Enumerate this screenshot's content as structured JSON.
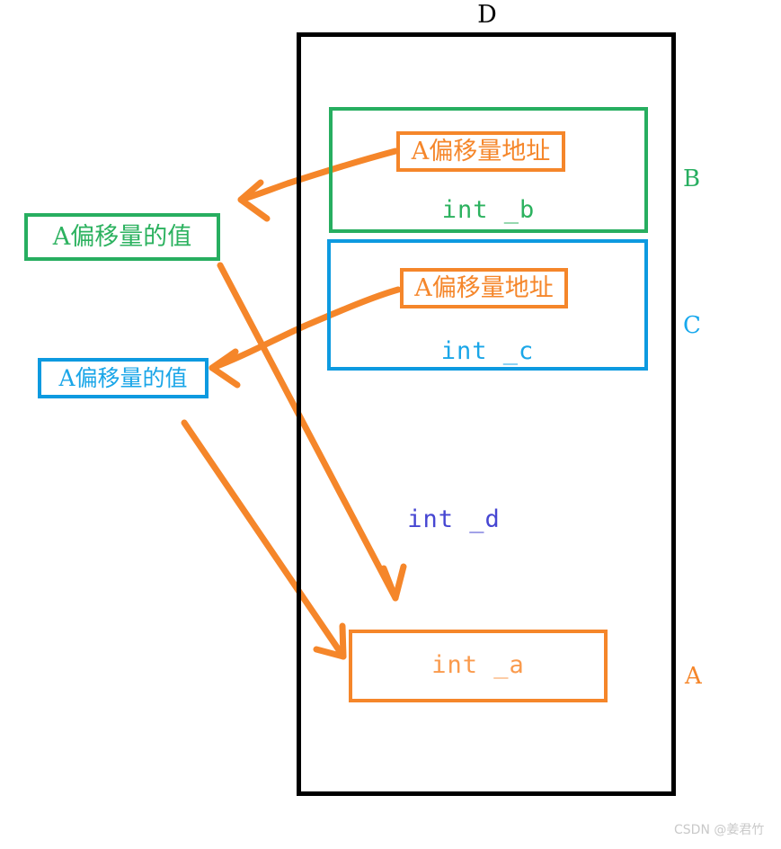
{
  "diagram": {
    "title_label": "D",
    "outer_block": {
      "name": "outer-struct-d",
      "label": "D",
      "color": "#000000"
    },
    "blocks": [
      {
        "id": "b",
        "side_label": "B",
        "color": "#27ae60",
        "member": "int _b",
        "address_box": "A偏移量地址"
      },
      {
        "id": "c",
        "side_label": "C",
        "color": "#0d9ae0",
        "member": "int _c",
        "address_box": "A偏移量地址"
      },
      {
        "id": "a",
        "side_label": "A",
        "color": "#f5862a",
        "member": "int _a",
        "address_box": null
      }
    ],
    "d_member": "int _d",
    "value_boxes": [
      {
        "id": "val-b",
        "text": "A偏移量的值",
        "color": "#27ae60"
      },
      {
        "id": "val-c",
        "text": "A偏移量的值",
        "color": "#0d9ae0"
      }
    ],
    "arrow_color": "#f5862a",
    "arrows": [
      {
        "name": "b-address-to-left",
        "from": "addr-box-b",
        "to": "left-of-d"
      },
      {
        "name": "c-address-to-left",
        "from": "addr-box-c",
        "to": "val-box-c"
      },
      {
        "name": "b-value-to-a-block",
        "from": "val-box-b",
        "to": "a-area"
      },
      {
        "name": "c-value-to-a-block",
        "from": "val-box-c",
        "to": "a-box"
      }
    ]
  },
  "watermark": {
    "text": "CSDN @姜君竹",
    "color": "#c9c9c9"
  }
}
